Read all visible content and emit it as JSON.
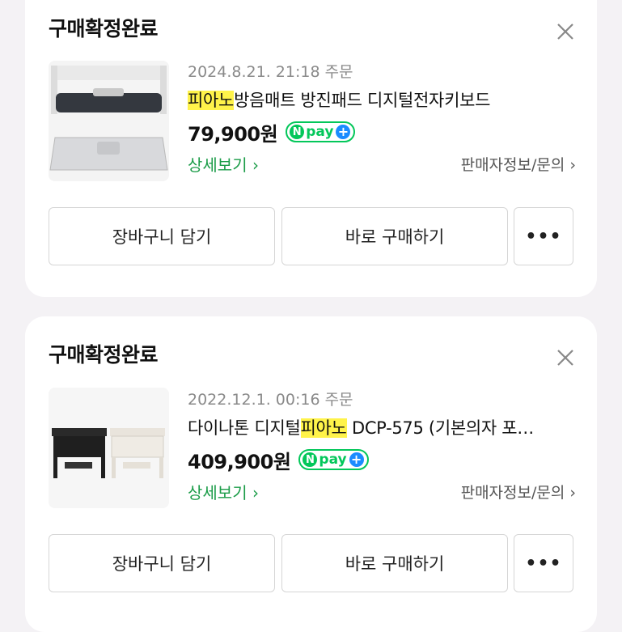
{
  "orders": [
    {
      "status": "구매확정완료",
      "date": "2024.8.21. 21:18 주문",
      "title_highlight": "피아노",
      "title_rest": "방음매트 방진패드 디지털전자키보드",
      "price": "79,900원",
      "npay_n": "N",
      "npay_label": "pay",
      "detail_link": "상세보기 ›",
      "seller_link": "판매자정보/문의 ›",
      "cart_button": "장바구니 담기",
      "buy_button": "바로 구매하기",
      "more_button": "•••",
      "close_icon": "close-icon"
    },
    {
      "status": "구매확정완료",
      "date": "2022.12.1. 00:16 주문",
      "title_before": "다이나톤 디지털",
      "title_highlight": "피아노",
      "title_after": " DCP-575 (기본의자 포…",
      "price": "409,900원",
      "npay_n": "N",
      "npay_label": "pay",
      "detail_link": "상세보기 ›",
      "seller_link": "판매자정보/문의 ›",
      "cart_button": "장바구니 담기",
      "buy_button": "바로 구매하기",
      "more_button": "•••",
      "close_icon": "close-icon"
    }
  ],
  "colors": {
    "accent_green": "#03c75a",
    "link_green": "#1b9c48",
    "highlight": "#fff34a",
    "npay_plus": "#1a8cff"
  }
}
